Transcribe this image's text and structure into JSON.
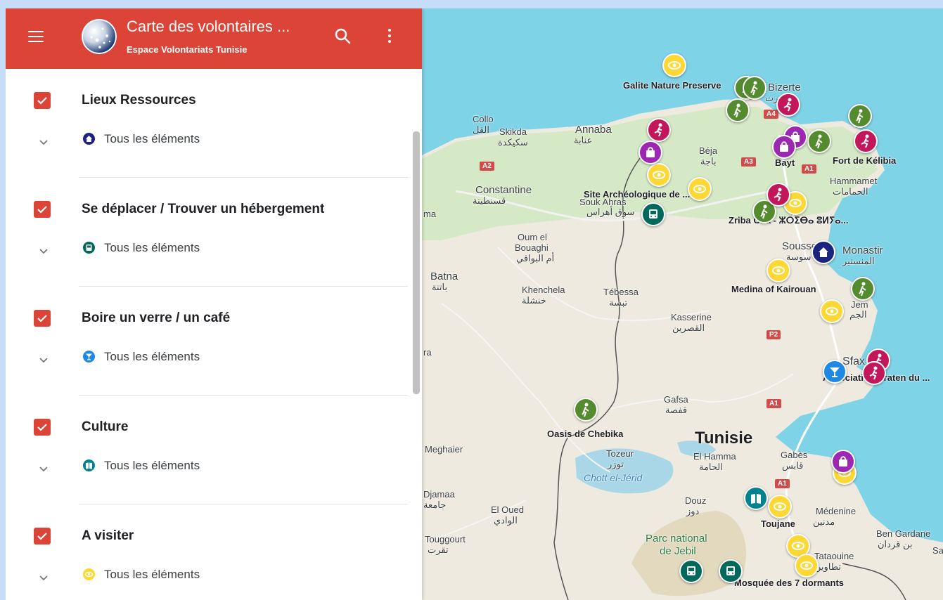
{
  "header": {
    "title": "Carte des volontaires ...",
    "subtitle": "Espace Volontariats Tunisie"
  },
  "layers": [
    {
      "title": "Lieux Ressources",
      "sub_label": "Tous les éléments",
      "icon": "home-icon",
      "color": "#1a237e",
      "checked": true
    },
    {
      "title": "Se déplacer / Trouver un hébergement",
      "sub_label": "Tous les éléments",
      "icon": "bus-icon",
      "color": "#00695c",
      "checked": true
    },
    {
      "title": "Boire un verre / un café",
      "sub_label": "Tous les éléments",
      "icon": "cocktail-icon",
      "color": "#1e88e5",
      "checked": true
    },
    {
      "title": "Culture",
      "sub_label": "Tous les éléments",
      "icon": "book-icon",
      "color": "#00838f",
      "checked": true
    },
    {
      "title": "A visiter",
      "sub_label": "Tous les éléments",
      "icon": "eye-icon",
      "color": "#fdd835",
      "checked": true
    }
  ],
  "map": {
    "places": {
      "collo": "Collo",
      "collo_ar": "القل",
      "skikda": "Skikda",
      "skikda_ar": "سكيكدة",
      "annaba": "Annaba",
      "annaba_ar": "عنابة",
      "beja": "Béja",
      "beja_ar": "باجة",
      "constantine": "Constantine",
      "constantine_ar": "قسنطينة",
      "souk_ahras": "Souk Ahras",
      "souk_ahras_ar": "سوق أهراس",
      "oum_el_bouaghi": "Oum el",
      "oum_el_bouaghi_2": "Bouaghi",
      "oum_el_bouaghi_ar": "أم البواقي",
      "batna": "Batna",
      "batna_ar": "باتنة",
      "khenchela": "Khenchela",
      "khenchela_ar": "خنشلة",
      "tebessa": "Tébessa",
      "tebessa_ar": "تبسة",
      "kasserine": "Kasserine",
      "kasserine_ar": "القصرين",
      "gafsa": "Gafsa",
      "gafsa_ar": "قفصة",
      "tozeur": "Tozeur",
      "tozeur_ar": "توزر",
      "meghaier": "Meghaier",
      "el_oued": "El Oued",
      "el_oued_ar": "الوادي",
      "touggourt": "Touggourt",
      "touggourt_ar": "تقرت",
      "djamaa": "Djamaa",
      "djamaa_ar": "جامعة",
      "el_hamma": "El Hamma",
      "el_hamma_ar": "الحامة",
      "gabes": "Gabès",
      "gabes_ar": "قابس",
      "douz": "Douz",
      "douz_ar": "دوز",
      "medenine": "Médenine",
      "medenine_ar": "مدنين",
      "ben_gardane": "Ben Gardane",
      "ben_gardane_ar": "بن قردان",
      "tataouine": "Tataouine",
      "tataouine_ar": "تطاوين",
      "hammamet": "Hammamet",
      "hammamet_ar": "الحمامات",
      "monastir": "Monastir",
      "monastir_ar": "المنستير",
      "sousse": "Sousse",
      "sousse_ar": "سوسة",
      "el_jem": "Jem",
      "el_jem_ar": "الجم",
      "sfax": "Sfax",
      "bizerte": "Bizerte",
      "bizerte_ar": "بنزرت",
      "tunisie": "Tunisie",
      "chott": "Chott el-Jérid",
      "parc_1": "Parc national",
      "parc_2": "de Jebil",
      "sa": "Sa",
      "ma": "ma",
      "ra": "ra"
    },
    "labels": {
      "galite": "Galite Nature Preserve",
      "fort_kelibia": "Fort de Kélibia",
      "bayt": "Bayt",
      "site_archeo": "Site Archéologique de ...",
      "zriba": "Zriba Olia - ⵣⵔⵉⴱⴰ ⵓⵍⵢⴰ...",
      "medina_kairouan": "Medina of Kairouan",
      "association": "Association Kraten du ...",
      "oasis": "Oasis de Chebika",
      "toujane": "Toujane",
      "mosquee": "Mosquée des 7 dormants"
    },
    "roads": [
      "A4",
      "A3",
      "A1",
      "A2",
      "P2",
      "A1",
      "A1"
    ]
  }
}
